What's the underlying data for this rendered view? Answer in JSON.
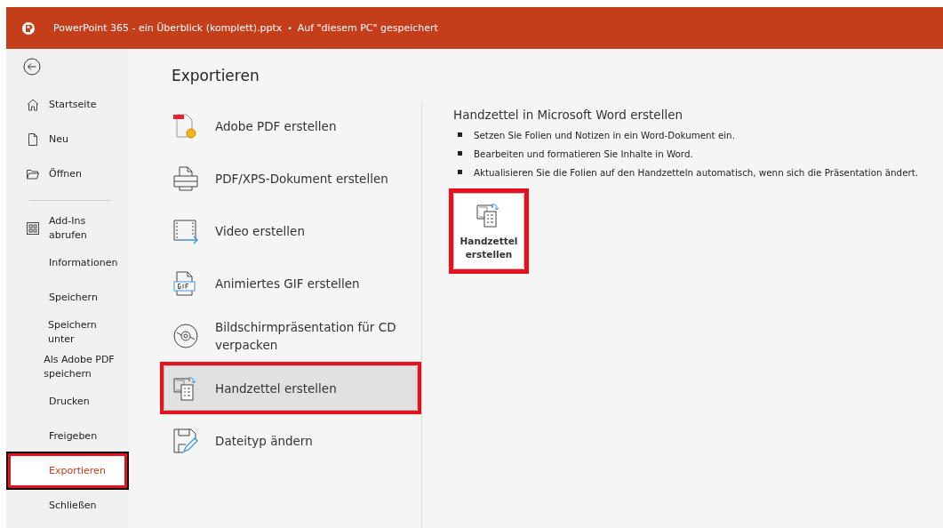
{
  "window": {
    "title": "PowerPoint 365 - ein Überblick (komplett).pptx",
    "separator": "•",
    "save_status": "Auf \"diesem PC\" gespeichert"
  },
  "sidebar": {
    "sections": [
      [
        {
          "label": "Startseite",
          "selected": false,
          "highlighted": false
        },
        {
          "label": "Neu",
          "selected": false,
          "highlighted": false
        },
        {
          "label": "Öffnen",
          "selected": false,
          "highlighted": false
        }
      ],
      [
        {
          "label": "Add-Ins abrufen",
          "selected": false,
          "highlighted": false
        },
        {
          "label": "Informationen",
          "selected": false,
          "highlighted": false
        },
        {
          "label": "Speichern",
          "selected": false,
          "highlighted": false
        },
        {
          "label": "Speichern unter",
          "selected": false,
          "highlighted": false
        },
        {
          "label": "Als Adobe PDF speichern",
          "selected": false,
          "highlighted": false
        },
        {
          "label": "Drucken",
          "selected": false,
          "highlighted": false
        },
        {
          "label": "Freigeben",
          "selected": false,
          "highlighted": false
        },
        {
          "label": "Exportieren",
          "selected": true,
          "highlighted": true
        },
        {
          "label": "Schließen",
          "selected": false,
          "highlighted": false
        }
      ]
    ]
  },
  "export": {
    "heading": "Exportieren",
    "options": [
      {
        "label": "Adobe PDF erstellen",
        "selected": false,
        "highlighted": false
      },
      {
        "label": "PDF/XPS-Dokument erstellen",
        "selected": false,
        "highlighted": false
      },
      {
        "label": "Video erstellen",
        "selected": false,
        "highlighted": false
      },
      {
        "label": "Animiertes GIF erstellen",
        "selected": false,
        "highlighted": false
      },
      {
        "label": "Bildschirmpräsentation für CD verpacken",
        "selected": false,
        "highlighted": false
      },
      {
        "label": "Handzettel erstellen",
        "selected": true,
        "highlighted": true
      },
      {
        "label": "Dateityp ändern",
        "selected": false,
        "highlighted": false
      }
    ]
  },
  "detail": {
    "title": "Handzettel in Microsoft Word erstellen",
    "bullets": [
      "Setzen Sie Folien und Notizen in ein Word-Dokument ein.",
      "Bearbeiten und formatieren Sie Inhalte in Word.",
      "Aktualisieren Sie die Folien auf den Handzetteln automatisch, wenn sich die Präsentation ändert."
    ],
    "button": {
      "label": "Handzettel erstellen",
      "highlighted": true
    }
  }
}
